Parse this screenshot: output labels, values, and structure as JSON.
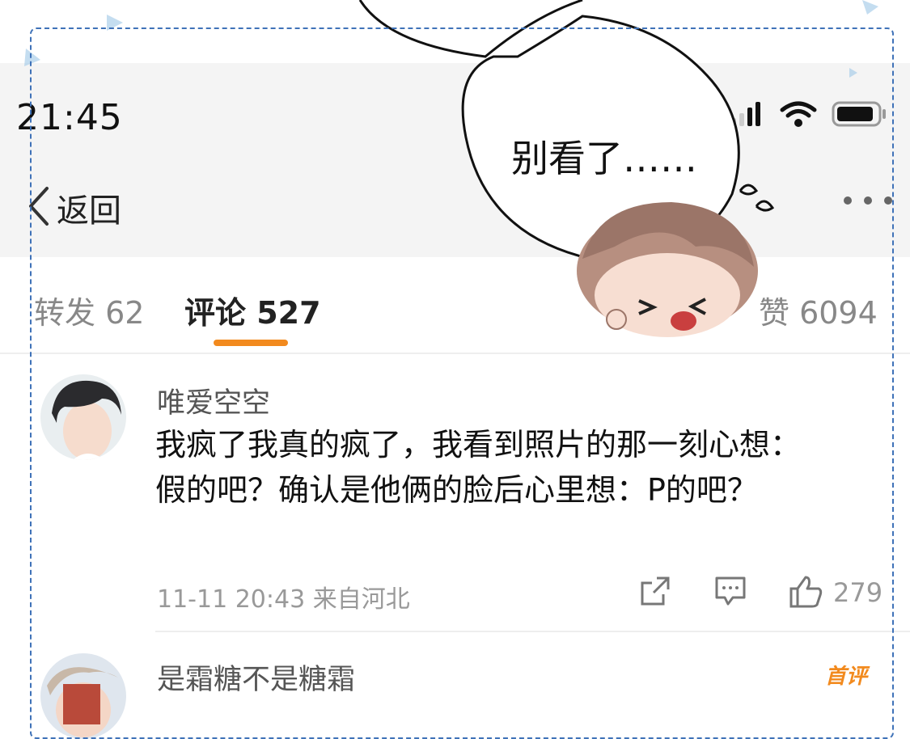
{
  "status": {
    "time": "21:45"
  },
  "nav": {
    "back_label": "返回"
  },
  "tabs": {
    "repost": "转发 62",
    "comments": "评论 527",
    "likes": "赞 6094",
    "accent_color": "#f28a1e"
  },
  "speech_bubble": {
    "text": "别看了……"
  },
  "comments": [
    {
      "username": "唯爱空空",
      "text": "我疯了我真的疯了，我看到照片的那一刻心想：\n假的吧？确认是他俩的脸后心里想：P的吧？",
      "meta": "11-11 20:43 来自河北",
      "likes": "279"
    },
    {
      "username": "是霜糖不是糖霜",
      "badge": "首评"
    }
  ],
  "icons": [
    "signal-icon",
    "wifi-icon",
    "battery-icon",
    "back-chevron-icon",
    "more-icon",
    "share-icon",
    "comment-icon",
    "thumbs-up-icon"
  ]
}
